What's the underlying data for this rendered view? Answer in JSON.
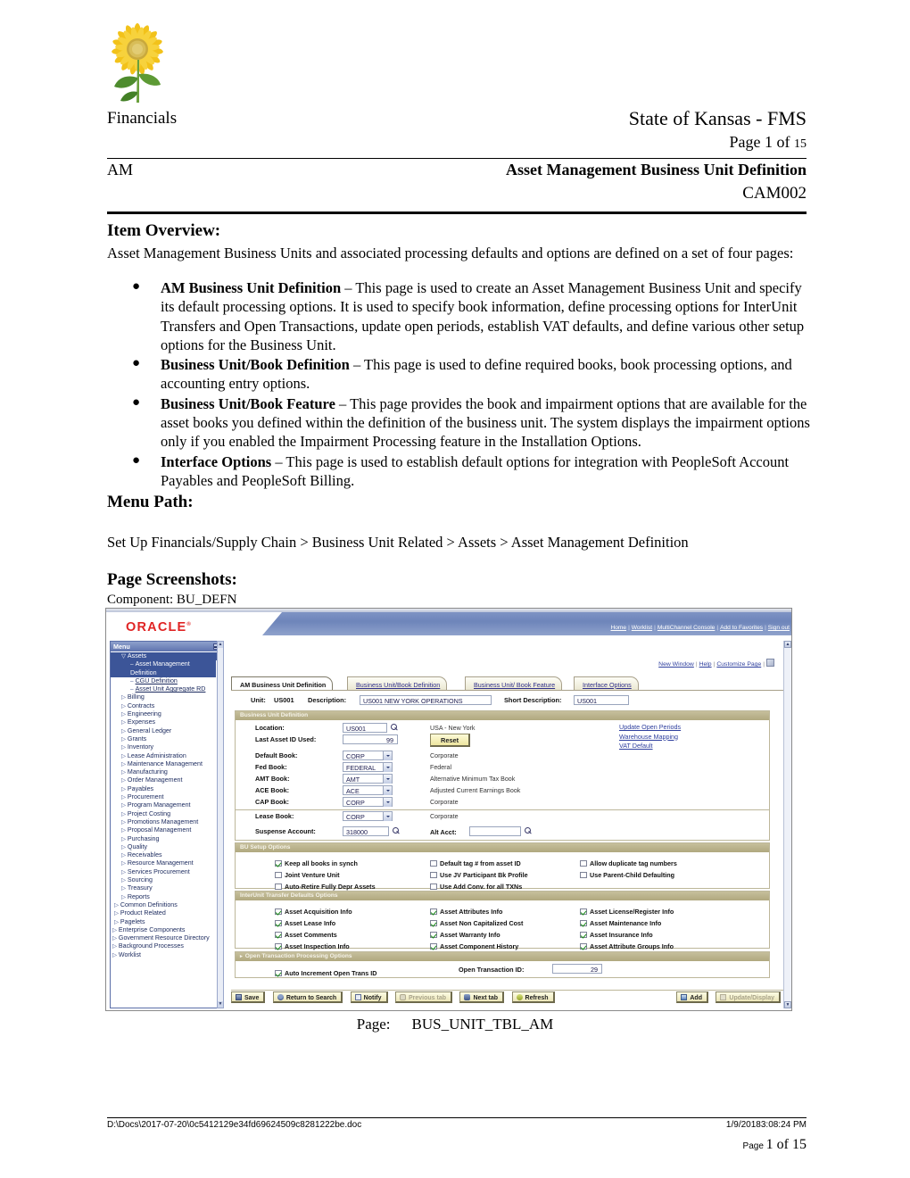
{
  "header": {
    "logo": "sunflower-logo",
    "left_label": "Financials",
    "org_title": "State of Kansas - FMS",
    "page_of_prefix": "Page 1 of ",
    "page_of_total": "15",
    "module": "AM",
    "doc_title": "Asset Management Business Unit Definition",
    "doc_code": "CAM002"
  },
  "item_overview": {
    "heading": "Item Overview:",
    "intro": "Asset Management Business Units and associated processing defaults and options are defined on a set of four pages:",
    "bullets": [
      {
        "term": "AM Business Unit Definition",
        "text": " – This page is used to create an Asset Management Business Unit and specify its default processing options.  It is used to specify book information, define processing options for InterUnit Transfers and Open Transactions, update open periods, establish VAT defaults, and define various other setup options for the Business Unit."
      },
      {
        "term": "Business Unit/Book Definition",
        "text": " – This page is used to define required books, book processing options, and accounting entry options."
      },
      {
        "term": "Business Unit/Book Feature",
        "text": " – This page provides the book and impairment options that are available for the asset books you defined within the definition of the business unit.  The system displays the impairment options only if you enabled the Impairment Processing feature in the Installation Options."
      },
      {
        "term": "Interface Options",
        "text": " – This page is used to establish default options for integration with PeopleSoft Account Payables and PeopleSoft Billing."
      }
    ]
  },
  "menu_path": {
    "heading": "Menu Path:",
    "value": "Set Up Financials/Supply Chain > Business Unit Related > Assets > Asset Management Definition"
  },
  "page_screenshots": {
    "heading": "Page Screenshots:",
    "component": "Component: BU_DEFN",
    "caption_label": "Page:",
    "caption_value": "BUS_UNIT_TBL_AM"
  },
  "screenshot": {
    "brand": "ORACLE",
    "brand_mark": "®",
    "top_nav": [
      "Home",
      "Worklist",
      "MultiChannel Console",
      "Add to Favorites",
      "Sign out"
    ],
    "page_links": [
      "New Window",
      "Help",
      "Customize Page"
    ],
    "http_icon": "http-icon",
    "menu": {
      "title": "Menu",
      "collapse_icon": "collapse-icon",
      "items": [
        {
          "label": "Assets",
          "level": 2,
          "marker": "expanded",
          "state": "selected"
        },
        {
          "label": "Asset Management Definition",
          "level": 3,
          "marker": "dash",
          "state": "selected"
        },
        {
          "label": "CGU Definition",
          "level": 3,
          "marker": "dash",
          "state": "link"
        },
        {
          "label": "Asset Unit Aggregate RD",
          "level": 3,
          "marker": "dash",
          "state": "link"
        },
        {
          "label": "Billing",
          "level": 2,
          "marker": "collapsed",
          "state": "normal"
        },
        {
          "label": "Contracts",
          "level": 2,
          "marker": "collapsed",
          "state": "normal"
        },
        {
          "label": "Engineering",
          "level": 2,
          "marker": "collapsed",
          "state": "normal"
        },
        {
          "label": "Expenses",
          "level": 2,
          "marker": "collapsed",
          "state": "normal"
        },
        {
          "label": "General Ledger",
          "level": 2,
          "marker": "collapsed",
          "state": "normal"
        },
        {
          "label": "Grants",
          "level": 2,
          "marker": "collapsed",
          "state": "normal"
        },
        {
          "label": "Inventory",
          "level": 2,
          "marker": "collapsed",
          "state": "normal"
        },
        {
          "label": "Lease Administration",
          "level": 2,
          "marker": "collapsed",
          "state": "normal"
        },
        {
          "label": "Maintenance Management",
          "level": 2,
          "marker": "collapsed",
          "state": "normal"
        },
        {
          "label": "Manufacturing",
          "level": 2,
          "marker": "collapsed",
          "state": "normal"
        },
        {
          "label": "Order Management",
          "level": 2,
          "marker": "collapsed",
          "state": "normal"
        },
        {
          "label": "Payables",
          "level": 2,
          "marker": "collapsed",
          "state": "normal"
        },
        {
          "label": "Procurement",
          "level": 2,
          "marker": "collapsed",
          "state": "normal"
        },
        {
          "label": "Program Management",
          "level": 2,
          "marker": "collapsed",
          "state": "normal"
        },
        {
          "label": "Project Costing",
          "level": 2,
          "marker": "collapsed",
          "state": "normal"
        },
        {
          "label": "Promotions Management",
          "level": 2,
          "marker": "collapsed",
          "state": "normal"
        },
        {
          "label": "Proposal Management",
          "level": 2,
          "marker": "collapsed",
          "state": "normal"
        },
        {
          "label": "Purchasing",
          "level": 2,
          "marker": "collapsed",
          "state": "normal"
        },
        {
          "label": "Quality",
          "level": 2,
          "marker": "collapsed",
          "state": "normal"
        },
        {
          "label": "Receivables",
          "level": 2,
          "marker": "collapsed",
          "state": "normal"
        },
        {
          "label": "Resource Management",
          "level": 2,
          "marker": "collapsed",
          "state": "normal"
        },
        {
          "label": "Services Procurement",
          "level": 2,
          "marker": "collapsed",
          "state": "normal"
        },
        {
          "label": "Sourcing",
          "level": 2,
          "marker": "collapsed",
          "state": "normal"
        },
        {
          "label": "Treasury",
          "level": 2,
          "marker": "collapsed",
          "state": "normal"
        },
        {
          "label": "Reports",
          "level": 2,
          "marker": "collapsed",
          "state": "normal"
        },
        {
          "label": "Common Definitions",
          "level": 1,
          "marker": "collapsed",
          "state": "normal"
        },
        {
          "label": "Product Related",
          "level": 1,
          "marker": "collapsed",
          "state": "normal"
        },
        {
          "label": "Pagelets",
          "level": 1,
          "marker": "collapsed",
          "state": "normal"
        },
        {
          "label": "Enterprise Components",
          "level": 0,
          "marker": "collapsed",
          "state": "normal"
        },
        {
          "label": "Government Resource Directory",
          "level": 0,
          "marker": "collapsed",
          "state": "normal"
        },
        {
          "label": "Background Processes",
          "level": 0,
          "marker": "collapsed",
          "state": "normal"
        },
        {
          "label": "Worklist",
          "level": 0,
          "marker": "collapsed",
          "state": "normal"
        }
      ]
    },
    "tabs": [
      {
        "label": "AM Business Unit Definition",
        "active": true
      },
      {
        "label": "Business Unit/Book Definition",
        "active": false
      },
      {
        "label": "Business Unit/ Book Feature",
        "active": false
      },
      {
        "label": "Interface Options",
        "active": false
      }
    ],
    "unit_row": {
      "unit_label": "Unit:",
      "unit_value": "US001",
      "description_label": "Description:",
      "description_value": "US001 NEW YORK OPERATIONS",
      "short_description_label": "Short Description:",
      "short_description_value": "US001"
    },
    "bu_definition": {
      "title": "Business Unit Definition",
      "location_label": "Location:",
      "location_value": "US001",
      "location_desc": "USA - New York",
      "last_asset_label": "Last Asset ID Used:",
      "last_asset_value": "99",
      "reset_button": "Reset",
      "links": [
        "Update Open Periods",
        "Warehouse Mapping",
        "VAT Default"
      ],
      "books": [
        {
          "label": "Default Book:",
          "value": "CORP",
          "desc": "Corporate"
        },
        {
          "label": "Fed Book:",
          "value": "FEDERAL",
          "desc": "Federal"
        },
        {
          "label": "AMT Book:",
          "value": "AMT",
          "desc": "Alternative Minimum Tax Book"
        },
        {
          "label": "ACE Book:",
          "value": "ACE",
          "desc": "Adjusted Current Earnings Book"
        },
        {
          "label": "CAP Book:",
          "value": "CORP",
          "desc": "Corporate"
        },
        {
          "label": "Lease Book:",
          "value": "CORP",
          "desc": "Corporate"
        }
      ],
      "suspense_label": "Suspense Account:",
      "suspense_value": "318000",
      "alt_acct_label": "Alt Acct:",
      "alt_acct_value": ""
    },
    "bu_setup_options": {
      "title": "BU Setup Options",
      "options": [
        {
          "label": "Keep all books in synch",
          "checked": true
        },
        {
          "label": "Default tag # from asset ID",
          "checked": false
        },
        {
          "label": "Allow duplicate tag numbers",
          "checked": false
        },
        {
          "label": "Joint Venture Unit",
          "checked": false
        },
        {
          "label": "Use JV Participant Bk Profile",
          "checked": false
        },
        {
          "label": "Use Parent-Child Defaulting",
          "checked": false
        },
        {
          "label": "Auto-Retire Fully Depr Assets",
          "checked": false
        },
        {
          "label": "Use Add Conv. for all TXNs",
          "checked": false
        }
      ]
    },
    "interunit_options": {
      "title": "InterUnit Transfer Defaults Options",
      "options": [
        {
          "label": "Asset Acquisition Info",
          "checked": true
        },
        {
          "label": "Asset Attributes Info",
          "checked": true
        },
        {
          "label": "Asset License/Register Info",
          "checked": true
        },
        {
          "label": "Asset Lease Info",
          "checked": true
        },
        {
          "label": "Asset Non Capitalized Cost",
          "checked": true
        },
        {
          "label": "Asset Maintenance Info",
          "checked": true
        },
        {
          "label": "Asset Comments",
          "checked": true
        },
        {
          "label": "Asset Warranty Info",
          "checked": true
        },
        {
          "label": "Asset Insurance Info",
          "checked": true
        },
        {
          "label": "Asset Inspection Info",
          "checked": true
        },
        {
          "label": "Asset Component History",
          "checked": true
        },
        {
          "label": "Asset Attribute Groups Info",
          "checked": true
        }
      ]
    },
    "open_transaction_options": {
      "title": "Open Transaction Processing Options",
      "auto_increment_label": "Auto Increment Open Trans ID",
      "auto_increment_checked": true,
      "open_trans_id_label": "Open Transaction ID:",
      "open_trans_id_value": "29"
    },
    "buttons": [
      {
        "label": "Save",
        "icon": "save-icon",
        "disabled": false
      },
      {
        "label": "Return to Search",
        "icon": "return-icon",
        "disabled": false
      },
      {
        "label": "Notify",
        "icon": "notify-icon",
        "disabled": false
      },
      {
        "label": "Previous tab",
        "icon": "previous-icon",
        "disabled": true
      },
      {
        "label": "Next tab",
        "icon": "next-icon",
        "disabled": false
      },
      {
        "label": "Refresh",
        "icon": "refresh-icon",
        "disabled": false
      }
    ],
    "buttons_right": [
      {
        "label": "Add",
        "icon": "add-icon",
        "disabled": false
      },
      {
        "label": "Update/Display",
        "icon": "update-icon",
        "disabled": true
      }
    ]
  },
  "footer": {
    "path": "D:\\Docs\\2017-07-20\\0c5412129e34fd69624509c8281222be.doc",
    "timestamp": "1/9/20183:08:24 PM",
    "page_prefix": "Page ",
    "page_number": "1 of 15"
  }
}
